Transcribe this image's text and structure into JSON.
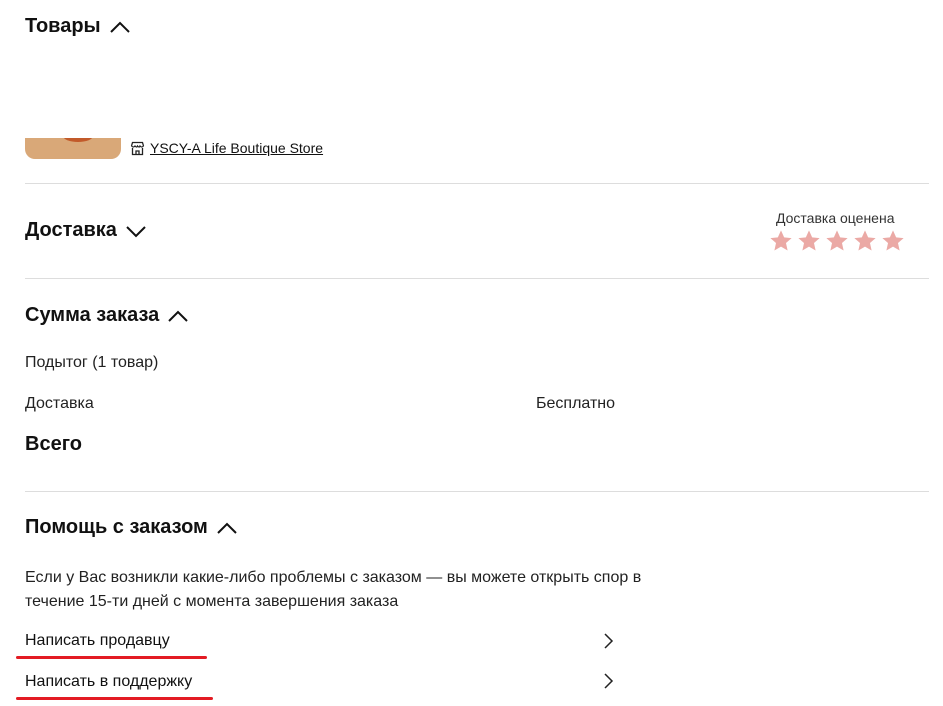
{
  "products": {
    "title": "Товары",
    "store_name": "YSCY-A Life Boutique Store"
  },
  "delivery": {
    "title": "Доставка",
    "rating_label": "Доставка оценена",
    "rating_value": 5,
    "rating_max": 5,
    "star_color": "#eba9a5"
  },
  "order_sum": {
    "title": "Сумма заказа",
    "subtotal_label": "Подытог (1 товар)",
    "shipping_label": "Доставка",
    "shipping_value": "Бесплатно",
    "total_label": "Всего"
  },
  "help": {
    "title": "Помощь с заказом",
    "description": "Если у Вас возникли какие-либо проблемы с заказом — вы можете открыть спор в течение 15-ти дней с момента завершения заказа",
    "links": [
      {
        "label": "Написать продавцу"
      },
      {
        "label": "Написать в поддержку"
      }
    ],
    "highlight_color": "#e31b23"
  }
}
